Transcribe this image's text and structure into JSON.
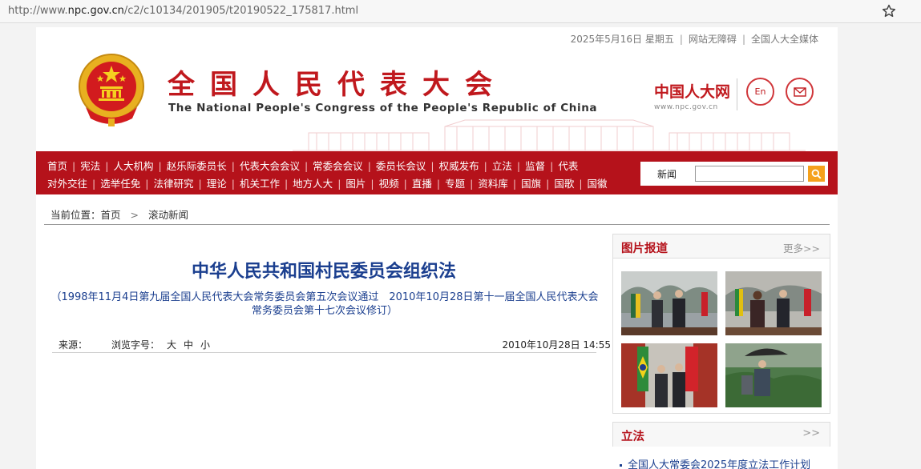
{
  "browser": {
    "url_prefix": "http://www.",
    "url_domain": "npc.gov.cn",
    "url_path": "/c2/c10134/201905/t20190522_175817.html"
  },
  "topbar": {
    "date": "2025年5月16日 星期五",
    "accessibility": "网站无障碍",
    "media": "全国人大全媒体"
  },
  "header": {
    "title": "全国人民代表大会",
    "subtitle": "The National People's Congress of the People's Republic of China",
    "logo_text": "中国人大网",
    "logo_domain": "www.npc.gov.cn",
    "en_label": "En"
  },
  "nav": {
    "row1": [
      "首页",
      "宪法",
      "人大机构",
      "赵乐际委员长",
      "代表大会会议",
      "常委会会议",
      "委员长会议",
      "权威发布",
      "立法",
      "监督",
      "代表"
    ],
    "row2": [
      "对外交往",
      "选举任免",
      "法律研究",
      "理论",
      "机关工作",
      "地方人大",
      "图片",
      "视频",
      "直播",
      "专题",
      "资料库",
      "国旗",
      "国歌",
      "国徽"
    ],
    "search_label": "新闻"
  },
  "breadcrumb": {
    "label": "当前位置：首页",
    "current": "滚动新闻"
  },
  "article": {
    "title": "中华人民共和国村民委员会组织法",
    "subtitle": "（1998年11月4日第九届全国人民代表大会常务委员会第五次会议通过　2010年10月28日第十一届全国人民代表大会常务委员会第十七次会议修订）",
    "source_label": "来源：",
    "font_label": "浏览字号：",
    "font_large": "大",
    "font_medium": "中",
    "font_small": "小",
    "date": "2010年10月28日 14:55"
  },
  "sidebar": {
    "photo_title": "图片报道",
    "more": "更多>>",
    "legislation_title": "立法",
    "legislation_more": ">>",
    "legislation_item": "全国人大常委会2025年度立法工作计划"
  },
  "colors": {
    "brand_red": "#b5121b",
    "title_blue": "#1b3f8f",
    "search_orange": "#f5a11c"
  }
}
